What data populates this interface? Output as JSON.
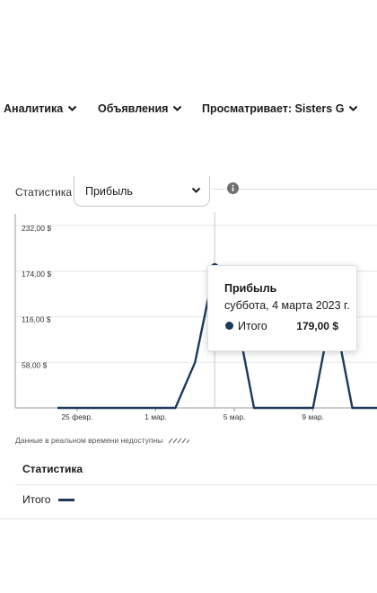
{
  "nav": {
    "analytics": "Аналитика",
    "ads": "Объявления",
    "viewing": "Просматривает: Sisters G"
  },
  "controls": {
    "stats_label": "Статистика",
    "selected_metric": "Прибыль"
  },
  "colors": {
    "series": "#1d3a5c",
    "grid": "#e6e6e6",
    "axis": "#9a9a9a"
  },
  "chart_data": {
    "type": "line",
    "x": [
      "2023-02-24",
      "2023-02-25",
      "2023-02-26",
      "2023-02-27",
      "2023-02-28",
      "2023-03-01",
      "2023-03-02",
      "2023-03-03",
      "2023-03-04",
      "2023-03-05",
      "2023-03-06",
      "2023-03-07",
      "2023-03-08",
      "2023-03-09",
      "2023-03-10",
      "2023-03-11",
      "2023-03-12",
      "2023-03-13"
    ],
    "series": [
      {
        "name": "Итого",
        "values": [
          0,
          0,
          0,
          0,
          0,
          0,
          0,
          58,
          179,
          130,
          0,
          0,
          0,
          0,
          130,
          0,
          0,
          0
        ]
      }
    ],
    "y_ticks": [
      "232,00 $",
      "174,00 $",
      "116,00 $",
      "58,00 $"
    ],
    "y_tick_values": [
      232,
      174,
      116,
      58
    ],
    "x_tick_labels": [
      "25 февр.",
      "1 мар.",
      "5 мар.",
      "9 мар.",
      "13 м"
    ],
    "x_tick_values": [
      "2023-02-25",
      "2023-03-01",
      "2023-03-05",
      "2023-03-09",
      "2023-03-13"
    ],
    "ylim": [
      0,
      240
    ],
    "hover_x": "2023-03-04",
    "grid": true
  },
  "tooltip": {
    "title": "Прибыль",
    "subtitle": "суббота, 4 марта 2023 г.",
    "series": "Итого",
    "value": "179,00 $"
  },
  "realtime_note": "Данные в реальном времени недоступны",
  "legend": {
    "title": "Статистика",
    "items": [
      {
        "label": "Итого"
      }
    ]
  }
}
